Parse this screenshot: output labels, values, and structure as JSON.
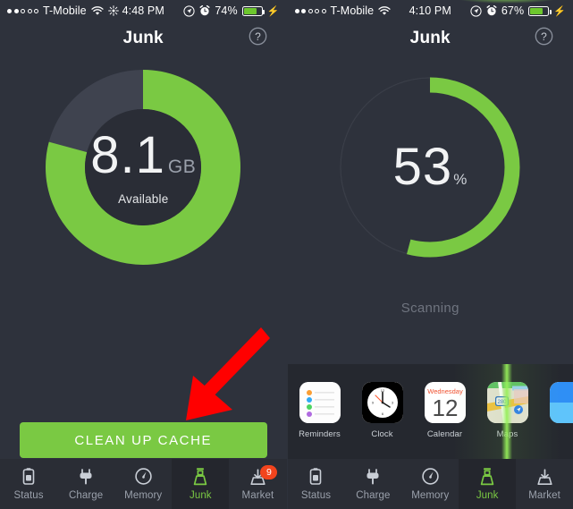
{
  "left": {
    "status_bar": {
      "signal_dots_filled": 2,
      "signal_dots_total": 5,
      "carrier": "T-Mobile",
      "wifi_icon": "wifi-icon",
      "brightness_icon": "brightness-icon",
      "time": "4:48 PM",
      "location_icon": "location-services-icon",
      "alarm_icon": "alarm-clock-icon",
      "battery_percent": "74%",
      "battery_fill": 74,
      "charging_icon": "lightning-bolt-icon"
    },
    "header": {
      "title": "Junk",
      "help_icon": "help-question-icon"
    },
    "donut": {
      "value": "8.1",
      "unit": "GB",
      "sub_label": "Available",
      "used_color": "#7ac943",
      "free_color": "#3f434f",
      "inner_color": "#2a2d36",
      "green_sweep_degrees": 285,
      "gray_sweep_degrees": 75
    },
    "cta_label": "CLEAN UP CACHE",
    "cta_color": "#7ac943",
    "arrow_color": "#ff0000",
    "tabs": [
      {
        "label": "Status",
        "icon": "battery-status-icon",
        "active": false,
        "badge": ""
      },
      {
        "label": "Charge",
        "icon": "power-plug-icon",
        "active": false,
        "badge": ""
      },
      {
        "label": "Memory",
        "icon": "gauge-meter-icon",
        "active": false,
        "badge": ""
      },
      {
        "label": "Junk",
        "icon": "broom-icon",
        "active": true,
        "badge": ""
      },
      {
        "label": "Market",
        "icon": "download-tray-icon",
        "active": false,
        "badge": "9"
      }
    ]
  },
  "right": {
    "status_bar": {
      "signal_dots_filled": 2,
      "signal_dots_total": 5,
      "carrier": "T-Mobile",
      "wifi_icon": "wifi-icon",
      "time": "4:10 PM",
      "location_icon": "location-services-icon",
      "alarm_icon": "alarm-clock-icon",
      "battery_percent": "67%",
      "battery_fill": 67,
      "charging_icon": "lightning-bolt-icon"
    },
    "header": {
      "title": "Junk",
      "help_icon": "help-question-icon"
    },
    "donut": {
      "value": "53",
      "unit": "%",
      "progress_percent": 53,
      "arc_color": "#7ac943",
      "track_color": "#3a3e48",
      "arc_sweep_degrees": 195
    },
    "status_label": "Scanning",
    "apps": [
      {
        "name": "Reminders",
        "icon": "reminders-app-icon"
      },
      {
        "name": "Clock",
        "icon": "clock-app-icon"
      },
      {
        "name": "Calendar",
        "icon": "calendar-app-icon",
        "weekday": "Wednesday",
        "day": "12"
      },
      {
        "name": "Maps",
        "icon": "maps-app-icon",
        "route_shield": "280"
      },
      {
        "name": "",
        "icon": "partial-app-icon"
      }
    ],
    "scan_beam_color": "#7ac943",
    "tabs": [
      {
        "label": "Status",
        "icon": "battery-status-icon",
        "active": false,
        "badge": ""
      },
      {
        "label": "Charge",
        "icon": "power-plug-icon",
        "active": false,
        "badge": ""
      },
      {
        "label": "Memory",
        "icon": "gauge-meter-icon",
        "active": false,
        "badge": ""
      },
      {
        "label": "Junk",
        "icon": "broom-icon",
        "active": true,
        "badge": ""
      },
      {
        "label": "Market",
        "icon": "download-tray-icon",
        "active": false,
        "badge": ""
      }
    ]
  }
}
